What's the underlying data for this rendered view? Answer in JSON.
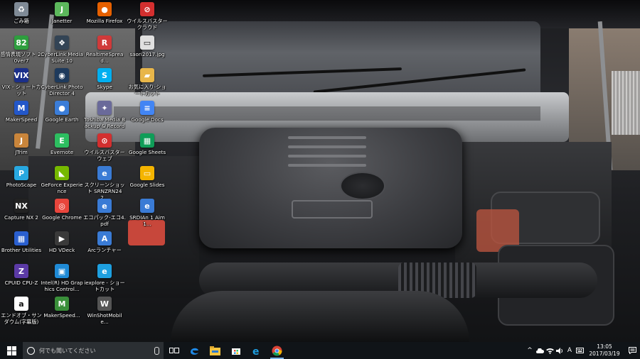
{
  "desktop": {
    "icons": [
      {
        "label": "ごみ箱",
        "icon": "recycle-bin-icon",
        "color": "#7f8a96",
        "glyph": "♻"
      },
      {
        "label": "感情表現ソフト 2.0ver7",
        "icon": "app-icon",
        "color": "#2e9e3e",
        "glyph": "82"
      },
      {
        "label": "VIX - ショートカット",
        "icon": "vix-icon",
        "color": "#1b2f8a",
        "glyph": "VIX"
      },
      {
        "label": "MakerSpeed",
        "icon": "makerspeed-icon",
        "color": "#2357c9",
        "glyph": "M"
      },
      {
        "label": "JTrim",
        "icon": "jtrim-icon",
        "color": "#c9853b",
        "glyph": "J"
      },
      {
        "label": "PhotoScape",
        "icon": "photoscape-icon",
        "color": "#28a8e0",
        "glyph": "P"
      },
      {
        "label": "Capture NX 2",
        "icon": "capture-nx-icon",
        "color": "#222222",
        "glyph": "NX"
      },
      {
        "label": "Brother Utilities",
        "icon": "brother-icon",
        "color": "#2a5fcf",
        "glyph": "▦"
      },
      {
        "label": "CPUID CPU-Z",
        "icon": "cpuz-icon",
        "color": "#5b3aa6",
        "glyph": "Z"
      },
      {
        "label": "エンドオブ・サンダウム(字幕版)",
        "icon": "amazon-icon",
        "color": "#ffffff",
        "glyph": "a"
      },
      {
        "label": "Janetter",
        "icon": "janetter-icon",
        "color": "#5cb85c",
        "glyph": "J"
      },
      {
        "label": "CyberLink Media Suite 10",
        "icon": "cyberlink-media-icon",
        "color": "#334455",
        "glyph": "❖"
      },
      {
        "label": "CyberLink PhotoDirector 4",
        "icon": "photodirector-icon",
        "color": "#1e3a5c",
        "glyph": "◉"
      },
      {
        "label": "Google Earth",
        "icon": "google-earth-icon",
        "color": "#3b7dd8",
        "glyph": "●"
      },
      {
        "label": "Evernote",
        "icon": "evernote-icon",
        "color": "#2dbe60",
        "glyph": "E"
      },
      {
        "label": "GeForce Experience",
        "icon": "geforce-icon",
        "color": "#76b900",
        "glyph": "◣"
      },
      {
        "label": "Google Chrome",
        "icon": "chrome-icon",
        "color": "#e8453c",
        "glyph": "◎"
      },
      {
        "label": "HD VDeck",
        "icon": "hd-vdeck-icon",
        "color": "#3a3a3a",
        "glyph": "▶"
      },
      {
        "label": "Intel(R) HD Graphics Control...",
        "icon": "intel-icon",
        "color": "#1f8ad6",
        "glyph": "▣"
      },
      {
        "label": "MakerSpeed...",
        "icon": "makerspeed2-icon",
        "color": "#3a8f3a",
        "glyph": "M"
      },
      {
        "label": "Mozilla Firefox",
        "icon": "firefox-icon",
        "color": "#e66000",
        "glyph": "●"
      },
      {
        "label": "RealtimeSpread...",
        "icon": "realtime-icon",
        "color": "#d03a3a",
        "glyph": "R"
      },
      {
        "label": "Skype",
        "icon": "skype-icon",
        "color": "#00aff0",
        "glyph": "S"
      },
      {
        "label": "Toshiba Media Backup & Record",
        "icon": "toshiba-icon",
        "color": "#6a6a9a",
        "glyph": "✦"
      },
      {
        "label": "ウイルスバスター ウェブ",
        "icon": "trend-icon",
        "color": "#d32f2f",
        "glyph": "⊙"
      },
      {
        "label": "スクリーンショット SRNZRN242...",
        "icon": "shortcut-icon",
        "color": "#3a7bd5",
        "glyph": "e"
      },
      {
        "label": "エコパック-エコ4.pdf",
        "icon": "pdf-icon",
        "color": "#3a7bd5",
        "glyph": "e"
      },
      {
        "label": "Arcランチャー",
        "icon": "arc-icon",
        "color": "#3a7bd5",
        "glyph": "A"
      },
      {
        "label": "iexplore - ショートカット",
        "icon": "ie-icon",
        "color": "#1ea0e0",
        "glyph": "e"
      },
      {
        "label": "WinShotMobile...",
        "icon": "winshot-icon",
        "color": "#555555",
        "glyph": "W"
      },
      {
        "label": "ウイルスバスター クラウド",
        "icon": "virusbuster-icon",
        "color": "#d32f2f",
        "glyph": "⊘"
      },
      {
        "label": "saori2017.jpg",
        "icon": "image-file-icon",
        "color": "#e0e0e0",
        "glyph": "▭"
      },
      {
        "label": "お気に入り-ショートカット",
        "icon": "folder-icon",
        "color": "#e8b64a",
        "glyph": "▰"
      },
      {
        "label": "Google Docs",
        "icon": "google-docs-icon",
        "color": "#4285f4",
        "glyph": "≡"
      },
      {
        "label": "Google Sheets",
        "icon": "google-sheets-icon",
        "color": "#0f9d58",
        "glyph": "▦"
      },
      {
        "label": "Google Slides",
        "icon": "google-slides-icon",
        "color": "#f4b400",
        "glyph": "▭"
      },
      {
        "label": "SRDIAn 1 Aim1...",
        "icon": "srdian-icon",
        "color": "#3a7bd5",
        "glyph": "e"
      }
    ]
  },
  "taskbar": {
    "search_placeholder": "何でも聞いてください",
    "pinned": [
      {
        "name": "task-view-button",
        "icon": "task-view-icon",
        "running": false
      },
      {
        "name": "edge-button",
        "icon": "edge-icon",
        "running": false
      },
      {
        "name": "file-explorer-button",
        "icon": "file-explorer-icon",
        "running": false
      },
      {
        "name": "store-button",
        "icon": "store-icon",
        "running": false
      },
      {
        "name": "ie-button",
        "icon": "ie-icon",
        "running": false
      },
      {
        "name": "chrome-button",
        "icon": "chrome-icon",
        "running": true
      }
    ],
    "tray": {
      "ime": "A",
      "time": "13:05",
      "date": "2017/03/19"
    }
  },
  "colors": {
    "taskbar_bg": "#101418",
    "search_bg": "#2b2f33",
    "accent": "#7ab3e8"
  }
}
